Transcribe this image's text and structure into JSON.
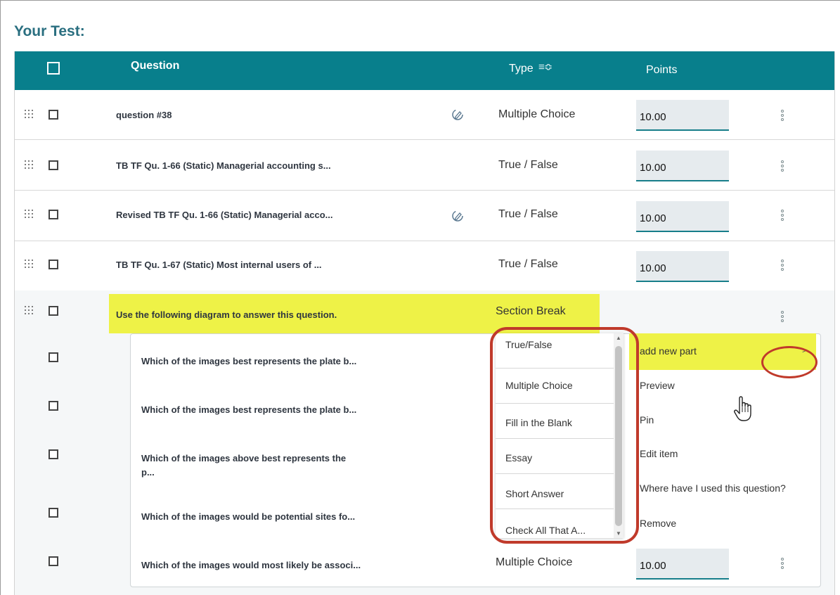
{
  "page": {
    "title": "Your Test:"
  },
  "table": {
    "headers": {
      "question": "Question",
      "type": "Type",
      "points": "Points"
    },
    "rows": [
      {
        "question": "question #38",
        "type": "Multiple Choice",
        "points": "10.00",
        "edit_icon": true
      },
      {
        "question": "TB TF Qu. 1-66 (Static) Managerial accounting s...",
        "type": "True / False",
        "points": "10.00",
        "edit_icon": false
      },
      {
        "question": "Revised TB TF Qu. 1-66 (Static) Managerial acco...",
        "type": "True / False",
        "points": "10.00",
        "edit_icon": true
      },
      {
        "question": "TB TF Qu. 1-67 (Static) Most internal users of ...",
        "type": "True / False",
        "points": "10.00",
        "edit_icon": false
      }
    ],
    "section": {
      "question": "Use the following diagram to answer this question.",
      "type": "Section Break",
      "sub_questions": [
        {
          "question": "Which of the images best represents the plate b..."
        },
        {
          "question": "Which of the images best represents the plate b..."
        },
        {
          "question_line1": "Which of the images above best represents the",
          "question_line2": "p..."
        },
        {
          "question": "Which of the images would be potential sites fo..."
        },
        {
          "question": "Which of the images would most likely be associ...",
          "type": "Multiple Choice",
          "points": "10.00"
        }
      ]
    }
  },
  "type_menu": {
    "items": [
      "True/False",
      "Multiple Choice",
      "Fill in the Blank",
      "Essay",
      "Short Answer",
      "Check All That A..."
    ]
  },
  "action_menu": {
    "items": [
      "add new part",
      "Preview",
      "Pin",
      "Edit item",
      "Where have I used this question?",
      "Remove"
    ],
    "submenu_arrow": ">"
  },
  "colors": {
    "header_teal": "#087f8c",
    "title": "#2a6f80",
    "highlight": "#eef247",
    "annotation_red": "#c03a2b"
  },
  "icons": {
    "drag": "drag-handle-icon",
    "edit": "edit-pencil-icon",
    "more": "kebab-more-icon",
    "sort": "sort-icon",
    "cursor": "hand-pointer-icon"
  }
}
